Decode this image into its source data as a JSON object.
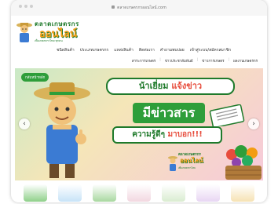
{
  "browser": {
    "url": "ตลาดเกษตรกรออนไลน์.com"
  },
  "header": {
    "logo_title": "ตลาดเกษตรกร",
    "logo_brand": "ออนไลน์",
    "logo_tagline": "เพื่อเกษตรกรไทย ทุกคน",
    "nav_main": [
      "ชนิดสินค้า",
      "ประเภทเกษตรกร",
      "แหล่งสินค้า",
      "ติดต่อเรา",
      "คำถามพบบ่อย",
      "เข้าสู่ระบบ/สมัครสมาชิก"
    ],
    "nav_sub": [
      "สาระการเกษตร",
      "ข่าวประชาสัมพันธ์",
      "ข่าวการเกษตร",
      "ผลงานเกษตรกร"
    ]
  },
  "hero": {
    "badge": "กลับหน้าหลัก",
    "headline_a": "น้าเยี่ยม ",
    "headline_b": "แจ้งข่าว",
    "news_text": "มีข่าวสาร",
    "sub_a": "ความรู้ดีๆ ",
    "sub_b": "มาบอก!!!",
    "small_logo_title": "ตลาดเกษตรกร",
    "small_logo_brand": "ออนไลน์",
    "small_logo_tagline": "เพื่อเกษตรกรไทย",
    "prev_icon": "‹",
    "next_icon": "›"
  },
  "colors": {
    "brand_green": "#1f7a2b",
    "brand_orange": "#f39c12",
    "accent_red": "#e74c3c"
  },
  "thumbnails": [
    "#8fd08a",
    "#c7e3f7",
    "#a8d8a0",
    "#f2d7e0",
    "#d9ecd0",
    "#e8d6f3",
    "#f6e2b3"
  ]
}
